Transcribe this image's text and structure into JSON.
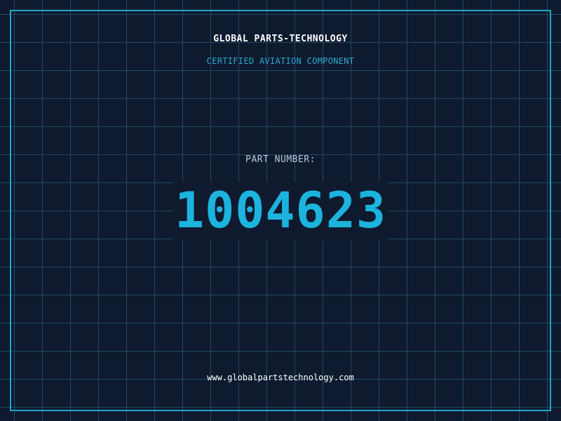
{
  "brand": "GLOBAL PARTS-TECHNOLOGY",
  "tagline": "CERTIFIED AVIATION COMPONENT",
  "part_number_label": "PART NUMBER:",
  "part_number": "1004623",
  "website": "www.globalpartstechnology.com",
  "colors": {
    "background": "#0f1a2e",
    "grid": "#1b4a63",
    "frame": "#1fa3cc",
    "accent": "#1cb4de",
    "label": "#b9c6d6",
    "text": "#ffffff"
  }
}
